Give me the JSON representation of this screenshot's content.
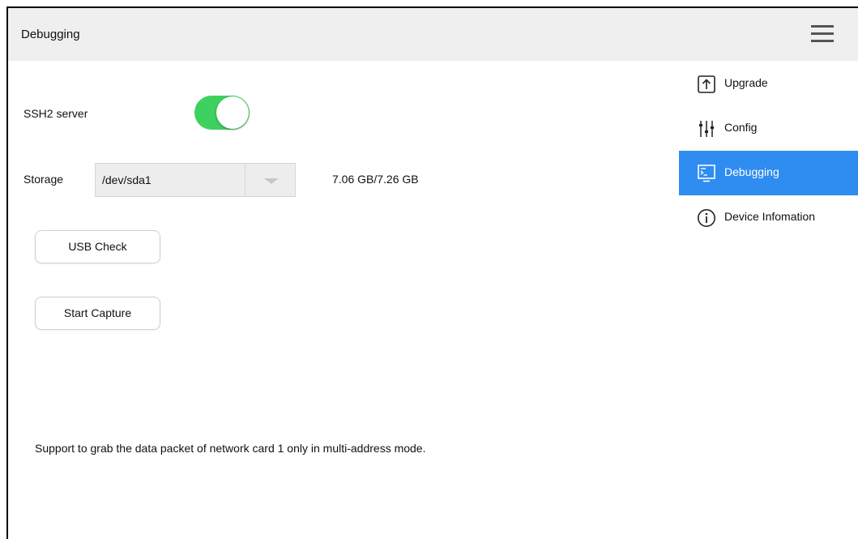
{
  "header": {
    "title": "Debugging",
    "menu_icon": "hamburger-menu-icon"
  },
  "ssh": {
    "label": "SSH2 server",
    "enabled": true,
    "on_color": "#3ed15f"
  },
  "storage": {
    "label": "Storage",
    "selected": "/dev/sda1",
    "usage": "7.06 GB/7.26 GB"
  },
  "buttons": {
    "usb_check": "USB Check",
    "start_capture": "Start Capture"
  },
  "note": "Support to grab the data packet of network card 1 only in multi-address mode.",
  "sidebar": {
    "active_color": "#2f8cf0",
    "items": [
      {
        "label": "Upgrade",
        "icon": "upgrade-arrow-icon",
        "active": false
      },
      {
        "label": "Config",
        "icon": "sliders-icon",
        "active": false
      },
      {
        "label": "Debugging",
        "icon": "terminal-monitor-icon",
        "active": true
      },
      {
        "label": "Device Infomation",
        "icon": "info-icon",
        "active": false
      }
    ]
  }
}
